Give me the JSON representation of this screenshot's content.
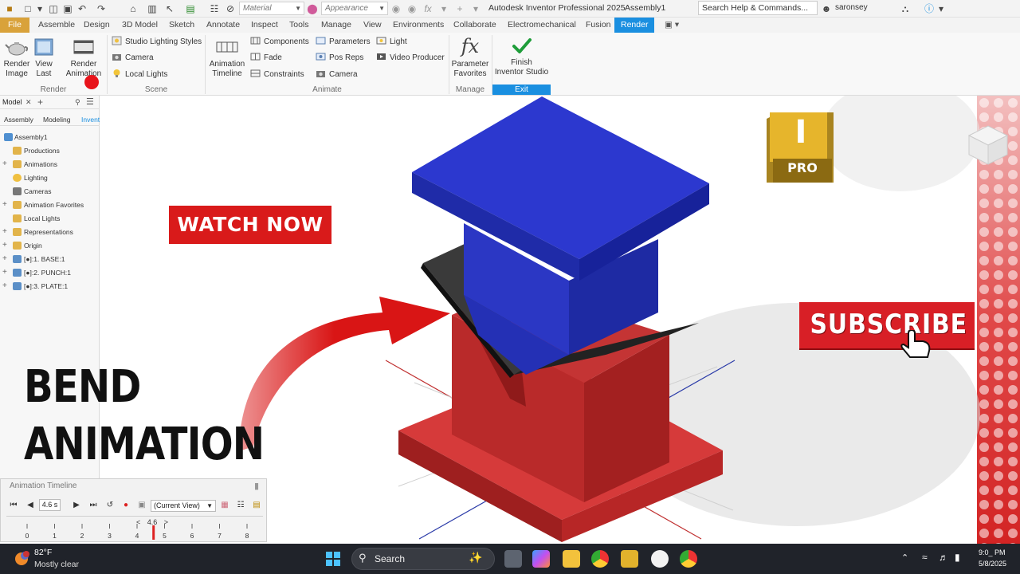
{
  "quick_access": {
    "material_placeholder": "Material",
    "appearance_placeholder": "Appearance",
    "app_title": "Autodesk Inventor Professional 2025",
    "document_title": "Assembly1",
    "help_search": "Search Help & Commands...",
    "user_name": "saronsey"
  },
  "ribbon_tabs": [
    {
      "label": "File"
    },
    {
      "label": "Assemble"
    },
    {
      "label": "Design"
    },
    {
      "label": "3D Model"
    },
    {
      "label": "Sketch"
    },
    {
      "label": "Annotate"
    },
    {
      "label": "Inspect"
    },
    {
      "label": "Tools"
    },
    {
      "label": "Manage"
    },
    {
      "label": "View"
    },
    {
      "label": "Environments"
    },
    {
      "label": "Collaborate"
    },
    {
      "label": "Electromechanical"
    },
    {
      "label": "Fusion"
    },
    {
      "label": "Render"
    }
  ],
  "ribbon": {
    "render": {
      "render_image": "Render\nImage",
      "view_last": "View\nLast",
      "render_animation": "Render\nAnimation",
      "group_label": "Render"
    },
    "scene": {
      "studio_lighting_styles": "Studio Lighting Styles",
      "camera": "Camera",
      "local_lights": "Local Lights",
      "group_label": "Scene"
    },
    "animate": {
      "animation_timeline": "Animation\nTimeline",
      "components": "Components",
      "fade": "Fade",
      "constraints": "Constraints",
      "parameters": "Parameters",
      "pos_reps": "Pos Reps",
      "camera": "Camera",
      "light": "Light",
      "video_producer": "Video Producer",
      "group_label": "Animate"
    },
    "manage": {
      "parameter_favorites": "Parameter\nFavorites",
      "group_label": "Manage"
    },
    "exit": {
      "finish_inventor_studio": "Finish\nInventor Studio",
      "group_label": "Exit"
    }
  },
  "browser": {
    "header": "Model",
    "tabs": [
      "Assembly",
      "Modeling",
      "Invent"
    ],
    "tree": [
      {
        "label": "Assembly1",
        "level": 0
      },
      {
        "label": "Productions",
        "level": 1
      },
      {
        "label": "Animations",
        "level": 1
      },
      {
        "label": "Lighting",
        "level": 1
      },
      {
        "label": "Cameras",
        "level": 1
      },
      {
        "label": "Animation Favorites",
        "level": 1
      },
      {
        "label": "Local Lights",
        "level": 1
      },
      {
        "label": "Representations",
        "level": 1
      },
      {
        "label": "Origin",
        "level": 1
      },
      {
        "label": "[●]:1. BASE:1",
        "level": 1
      },
      {
        "label": "[●]:2. PUNCH:1",
        "level": 1
      },
      {
        "label": "[●]:3. PLATE:1",
        "level": 1
      }
    ]
  },
  "overlays": {
    "watch_now": "WATCH NOW",
    "title_line1": "BEND",
    "title_line2": "ANIMATION",
    "subscribe": "SUBSCRIBE",
    "logo_letter": "I",
    "logo_badge": "PRO"
  },
  "timeline": {
    "title": "Animation Timeline",
    "current_time": "4.6 s",
    "view_select": "(Current View)",
    "marker_value": "4.6",
    "ticks": [
      "0",
      "1",
      "2",
      "3",
      "4",
      "5",
      "6",
      "7",
      "8"
    ],
    "marker_position": 4.6
  },
  "taskbar": {
    "weather_temp": "82°F",
    "weather_desc": "Mostly clear",
    "search_label": "Search",
    "clock_time": "9:0_ PM",
    "clock_date": "5/8/2025"
  },
  "colors": {
    "accent": "#1a8fe0",
    "file_tab": "#d9a23a",
    "punch_blue": "#2a36c8",
    "die_red": "#c42a2a",
    "sheet": "#333333",
    "logo_gold": "#e0b22d"
  }
}
